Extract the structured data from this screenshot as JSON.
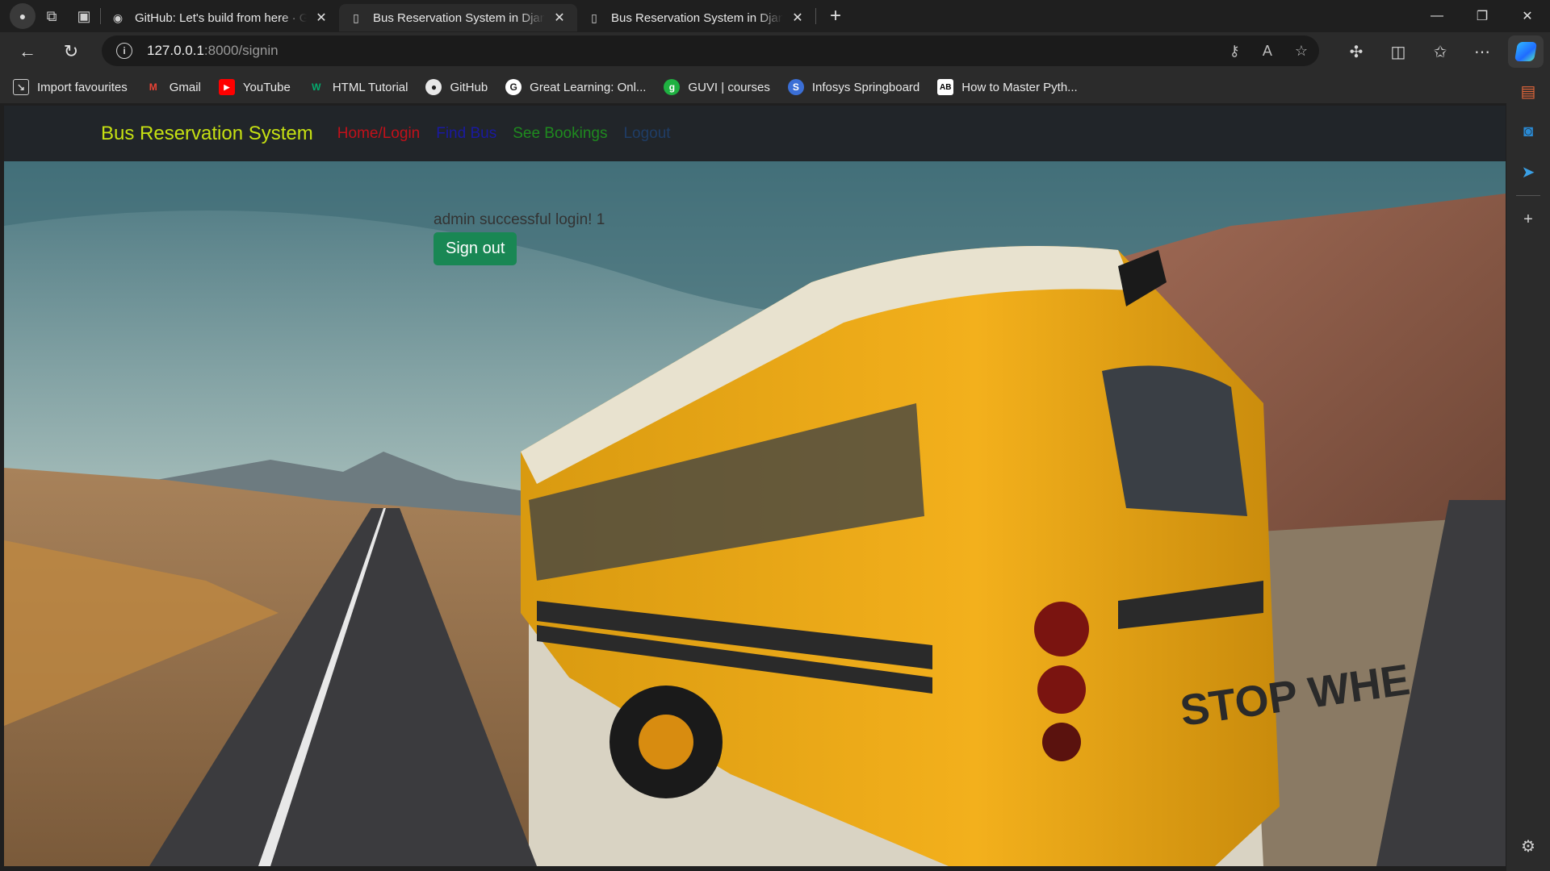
{
  "browser": {
    "tabs": [
      {
        "title": "GitHub: Let's build from here · Gi",
        "icon": "github-icon",
        "active": false
      },
      {
        "title": "Bus Reservation System in Djang",
        "icon": "page-icon",
        "active": true
      },
      {
        "title": "Bus Reservation System in Djang",
        "icon": "page-icon",
        "active": false
      }
    ],
    "address": {
      "host": "127.0.0.1",
      "path": ":8000/signin"
    },
    "bookmarks": [
      {
        "label": "Import favourites",
        "icon": "import-icon"
      },
      {
        "label": "Gmail",
        "icon": "gmail-icon"
      },
      {
        "label": "YouTube",
        "icon": "youtube-icon"
      },
      {
        "label": "HTML Tutorial",
        "icon": "w3schools-icon"
      },
      {
        "label": "GitHub",
        "icon": "github-icon"
      },
      {
        "label": "Great Learning: Onl...",
        "icon": "great-learning-icon"
      },
      {
        "label": "GUVI | courses",
        "icon": "guvi-icon"
      },
      {
        "label": "Infosys Springboard",
        "icon": "infosys-icon"
      },
      {
        "label": "How to Master Pyth...",
        "icon": "ab-icon"
      }
    ]
  },
  "site": {
    "brand": "Bus Reservation System",
    "nav": [
      {
        "label": "Home/Login",
        "color": "#c0111a"
      },
      {
        "label": "Find Bus",
        "color": "#1a1aa0"
      },
      {
        "label": "See Bookings",
        "color": "#1f8a1f"
      },
      {
        "label": "Logout",
        "color": "#1f3d66"
      }
    ],
    "message": "admin successful login! 1",
    "signout_label": "Sign out",
    "colors": {
      "navbar": "#212529",
      "brand": "#c6e012",
      "signout": "#198754"
    }
  }
}
